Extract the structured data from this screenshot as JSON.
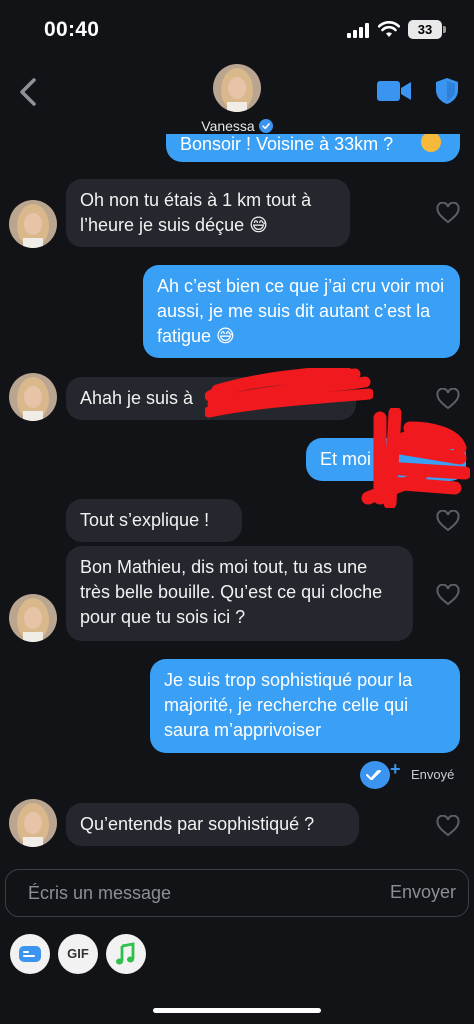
{
  "status_bar": {
    "time": "00:40",
    "battery": "33"
  },
  "header": {
    "contact_name": "Vanessa"
  },
  "messages": [
    {
      "side": "out",
      "text": "Bonsoir ! Voisine à 33km ?"
    },
    {
      "side": "in",
      "text": "Oh non tu étais à 1 km tout à l’heure je suis déçue 😅"
    },
    {
      "side": "out",
      "text": "Ah c’est bien ce que j’ai cru voir moi aussi, je me suis dit autant c’est la fatigue 😅"
    },
    {
      "side": "in",
      "text": "Ahah je suis à"
    },
    {
      "side": "out",
      "text": "Et moi"
    },
    {
      "side": "in",
      "text": "Tout s’explique !"
    },
    {
      "side": "in",
      "text": "Bon Mathieu, dis moi tout, tu as une très belle bouille. Qu’est ce qui cloche pour que tu sois ici ?"
    },
    {
      "side": "out",
      "text": "Je suis trop sophistiqué pour la majorité, je recherche celle qui saura m’apprivoiser"
    },
    {
      "side": "in",
      "text": "Qu’entends par sophistiqué ?"
    }
  ],
  "delivery_status": "Envoyé",
  "composer": {
    "placeholder": "Écris un message",
    "send_label": "Envoyer"
  },
  "tools": {
    "gif_label": "GIF"
  },
  "colors": {
    "accent": "#3aa0f5",
    "incoming_bubble": "#24272d",
    "background": "#111317",
    "redaction": "#f0191e"
  }
}
